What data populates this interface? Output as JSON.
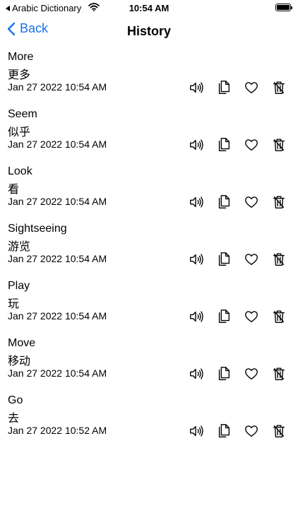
{
  "status_bar": {
    "carrier": "Arabic Dictionary",
    "time": "10:54 AM"
  },
  "nav": {
    "back_label": "Back",
    "title": "History"
  },
  "history": [
    {
      "word": "More",
      "translation": "更多",
      "timestamp": "Jan 27 2022 10:54 AM"
    },
    {
      "word": "Seem",
      "translation": "似乎",
      "timestamp": "Jan 27 2022 10:54 AM"
    },
    {
      "word": "Look",
      "translation": "看",
      "timestamp": "Jan 27 2022 10:54 AM"
    },
    {
      "word": "Sightseeing",
      "translation": "游览",
      "timestamp": "Jan 27 2022 10:54 AM"
    },
    {
      "word": "Play",
      "translation": "玩",
      "timestamp": "Jan 27 2022 10:54 AM"
    },
    {
      "word": "Move",
      "translation": "移动",
      "timestamp": "Jan 27 2022 10:54 AM"
    },
    {
      "word": "Go",
      "translation": "去",
      "timestamp": "Jan 27 2022 10:52 AM"
    }
  ],
  "icons": {
    "speak": "speaker-icon",
    "copy": "copy-icon",
    "favorite": "heart-icon",
    "delete": "trash-icon"
  },
  "colors": {
    "accent": "#1a73e8"
  }
}
